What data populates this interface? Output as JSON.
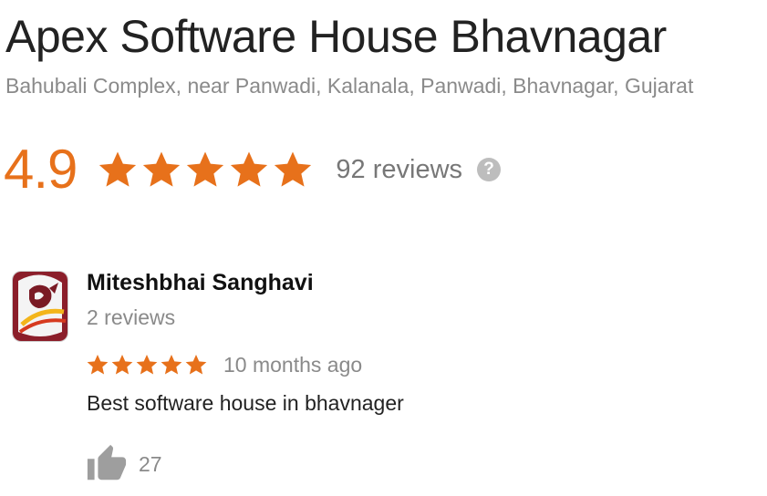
{
  "place": {
    "name": "Apex Software House Bhavnagar",
    "address": "Bahubali Complex, near Panwadi, Kalanala, Panwadi, Bhavnagar, Gujarat",
    "rating": "4.9",
    "rating_value": 4.9,
    "stars_filled": 5,
    "reviews_label": "92 reviews",
    "help_glyph": "?",
    "star_icon": "star-icon",
    "help_icon": "question-circle-icon"
  },
  "review": {
    "author": "Miteshbhai Sanghavi",
    "author_reviews": "2 reviews",
    "stars": 5,
    "date": "10 months ago",
    "text": "Best software house in bhavnager",
    "likes": "27",
    "avatar_icon": "profile-avatar",
    "like_icon": "thumbs-up-icon"
  },
  "colors": {
    "accent": "#e7711b",
    "title": "#222222",
    "muted": "#8a8a8a",
    "icon_gray": "#bdbdbd",
    "avatar_maroon": "#8b1e2a",
    "avatar_gold": "#f3b51b"
  }
}
